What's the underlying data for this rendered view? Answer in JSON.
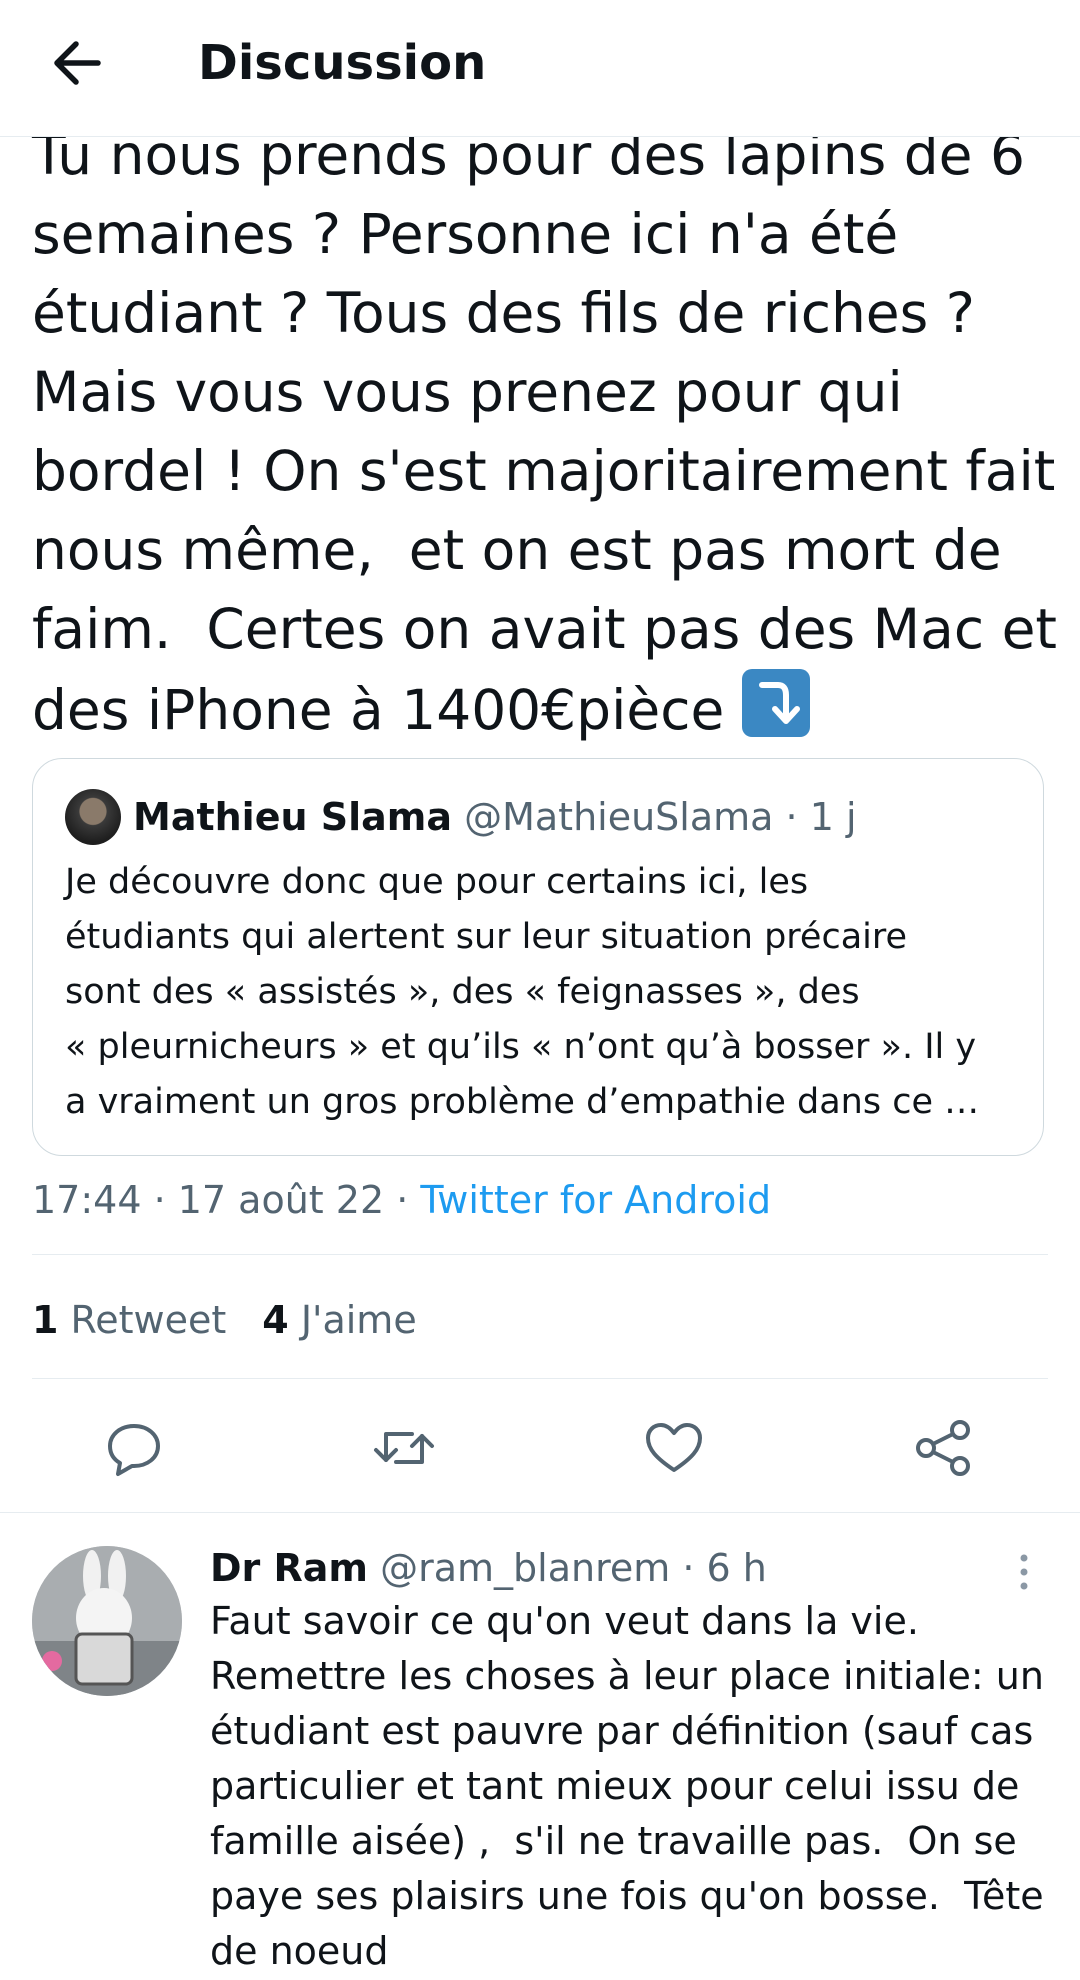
{
  "header": {
    "title": "Discussion"
  },
  "main_tweet": {
    "text": "Tu nous prends pour des lapins de 6\nsemaines ? Personne ici n'a été\nétudiant ? Tous des fils de riches ?\nMais vous vous prenez pour qui\nbordel ! On s'est majoritairement fait\nnous même,  et on est pas mort de\nfaim.  Certes on avait pas des Mac et\ndes iPhone à 1400€pièce ",
    "emoji": "arrow-down-emoji",
    "timestamp": "17:44 · 17 août 22 · ",
    "source": "Twitter for Android",
    "retweets_count": "1",
    "retweets_label": "Retweet",
    "likes_count": "4",
    "likes_label": "J'aime"
  },
  "quoted_tweet": {
    "name": "Mathieu Slama",
    "meta": " @MathieuSlama · 1 j",
    "text": "Je découvre donc que pour certains ici, les\nétudiants qui alertent sur leur situation précaire\nsont des « assistés », des « feignasses », des\n« pleurnicheurs » et qu’ils « n’ont qu’à bosser ». Il y\na vraiment un gros problème d’empathie dans ce …"
  },
  "actions": [
    "reply-icon",
    "retweet-icon",
    "like-icon",
    "share-icon"
  ],
  "reply": {
    "name": "Dr Ram",
    "meta": " @ram_blanrem · 6 h",
    "text": "Faut savoir ce qu'on veut dans la vie.\nRemettre les choses à leur place initiale: un\nétudiant est pauvre par définition (sauf cas\nparticulier et tant mieux pour celui issu de\nfamille aisée) ,  s'il ne travaille pas.  On se\npaye ses plaisirs une fois qu'on bosse.  Tête\nde noeud"
  },
  "colors": {
    "accent": "#1d9bf0",
    "secondary_text": "#536471",
    "border": "#cfd9de"
  }
}
